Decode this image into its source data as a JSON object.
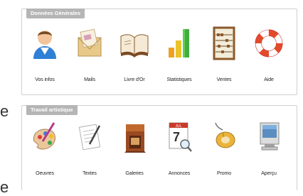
{
  "edge_fragments": [
    "e",
    "e"
  ],
  "panels": [
    {
      "title": "Données Générales",
      "items": [
        {
          "label": "Vos infos",
          "icon": "user-icon"
        },
        {
          "label": "Mails",
          "icon": "envelope-icon"
        },
        {
          "label": "Livre d'Or",
          "icon": "open-book-icon"
        },
        {
          "label": "Statistiques",
          "icon": "bar-chart-icon"
        },
        {
          "label": "Ventes",
          "icon": "abacus-icon"
        },
        {
          "label": "Aide",
          "icon": "lifebuoy-icon"
        }
      ]
    },
    {
      "title": "Travail artistique",
      "items": [
        {
          "label": "Oeuvres",
          "icon": "paint-palette-icon"
        },
        {
          "label": "Textes",
          "icon": "document-pen-icon"
        },
        {
          "label": "Galeries",
          "icon": "gallery-building-icon"
        },
        {
          "label": "Annonces",
          "icon": "calendar-magnifier-icon"
        },
        {
          "label": "Promo",
          "icon": "mouse-icon"
        },
        {
          "label": "Aperçu",
          "icon": "monitor-icon"
        }
      ]
    }
  ],
  "calendar": {
    "month": "JUL",
    "day": "7"
  }
}
